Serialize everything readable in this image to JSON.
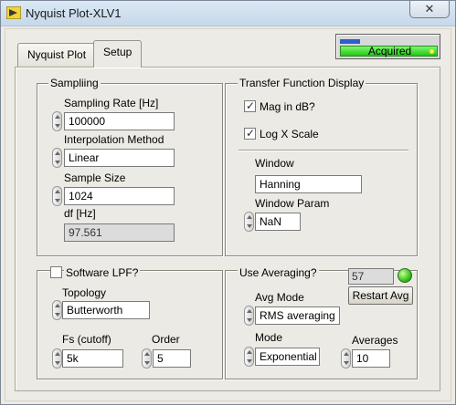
{
  "window": {
    "title": "Nyquist Plot-XLV1",
    "close_label": "✕"
  },
  "tabs": [
    {
      "label": "Nyquist Plot"
    },
    {
      "label": "Setup"
    }
  ],
  "status": {
    "text": "Acquired"
  },
  "sampling": {
    "title": "Sampliing",
    "rate_label": "Sampling Rate [Hz]",
    "rate_value": "100000",
    "interp_label": "Interpolation Method",
    "interp_value": "Linear",
    "size_label": "Sample Size",
    "size_value": "1024",
    "df_label": "df [Hz]",
    "df_value": "97.561"
  },
  "tfd": {
    "title": "Transfer Function Display",
    "mag_db_label": "Mag in dB?",
    "mag_db_checked": true,
    "logx_label": "Log X Scale",
    "logx_checked": true,
    "window_label": "Window",
    "window_value": "Hanning",
    "window_param_label": "Window Param",
    "window_param_value": "NaN"
  },
  "lpf": {
    "checkbox_label": "Software LPF?",
    "checked": false,
    "topology_label": "Topology",
    "topology_value": "Butterworth",
    "fs_label": "Fs (cutoff)",
    "fs_value": "5k",
    "order_label": "Order",
    "order_value": "5"
  },
  "averaging": {
    "title": "Use Averaging?",
    "count_value": "57",
    "restart_label": "Restart Avg",
    "avg_mode_label": "Avg Mode",
    "avg_mode_value": "RMS averaging",
    "mode_label": "Mode",
    "mode_value": "Exponential",
    "averages_label": "Averages",
    "averages_value": "10"
  },
  "colors": {
    "led_on": "#38c21a",
    "status_fill": "#23c617",
    "progress_blue": "#2c5fd2"
  }
}
